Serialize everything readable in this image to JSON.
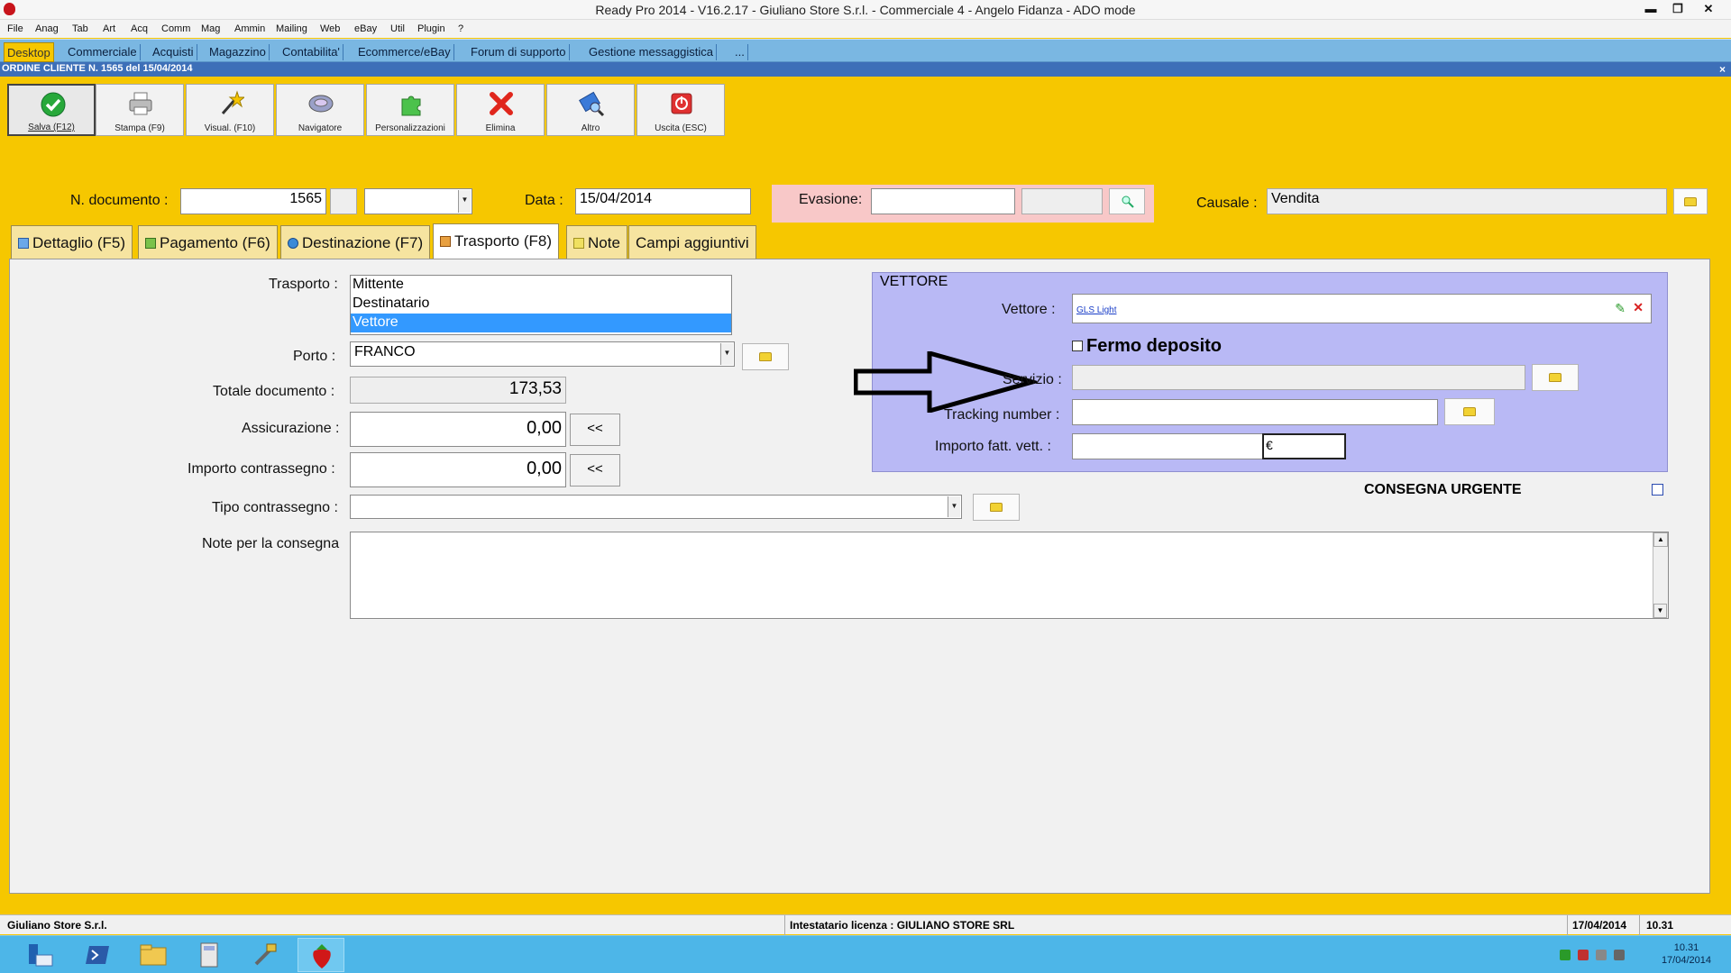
{
  "window": {
    "title": "Ready Pro 2014 - V16.2.17 - Giuliano Store S.r.l. - Commerciale 4 - Angelo Fidanza - ADO mode",
    "min": "▬",
    "restore": "❐",
    "close": "✕"
  },
  "menu": [
    "File",
    "Anag",
    "Tab",
    "Art",
    "Acq",
    "Comm",
    "Mag",
    "Ammin",
    "Mailing",
    "Web",
    "eBay",
    "Util",
    "Plugin",
    "?"
  ],
  "modules": [
    "Desktop",
    "Commerciale",
    "Acquisti",
    "Magazzino",
    "Contabilita'",
    "Ecommerce/eBay",
    "Forum di supporto",
    "Gestione messaggistica",
    "..."
  ],
  "doc_title": "ORDINE CLIENTE N. 1565 del 15/04/2014",
  "doc_close": "×",
  "toolbar": [
    {
      "label": "Salva (F12)",
      "icon": "check-icon"
    },
    {
      "label": "Stampa (F9)",
      "icon": "printer-icon"
    },
    {
      "label": "Visual. (F10)",
      "icon": "magic-wand-icon"
    },
    {
      "label": "Navigatore",
      "icon": "navigator-icon"
    },
    {
      "label": "Personalizzazioni",
      "icon": "puzzle-icon"
    },
    {
      "label": "Elimina",
      "icon": "delete-x-icon"
    },
    {
      "label": "Altro",
      "icon": "altro-icon"
    },
    {
      "label": "Uscita (ESC)",
      "icon": "exit-icon"
    }
  ],
  "header": {
    "ndoc_label": "N. documento :",
    "ndoc_value": "1565",
    "data_label": "Data :",
    "data_value": "15/04/2014",
    "evasione_label": "Evasione:",
    "evasione_value": "",
    "causale_label": "Causale :",
    "causale_value": "Vendita"
  },
  "tabs": [
    "Dettaglio (F5)",
    "Pagamento (F6)",
    "Destinazione (F7)",
    "Trasporto (F8)",
    "Note",
    "Campi aggiuntivi"
  ],
  "active_tab": "Trasporto (F8)",
  "trasporto": {
    "trasporto_label": "Trasporto :",
    "trasporto_options": [
      "Mittente",
      "Destinatario",
      "Vettore"
    ],
    "trasporto_selected": "Vettore",
    "porto_label": "Porto :",
    "porto_value": "FRANCO",
    "totale_label": "Totale documento :",
    "totale_value": "173,53",
    "assicurazione_label": "Assicurazione :",
    "assicurazione_value": "0,00",
    "importo_contr_label": "Importo contrassegno :",
    "importo_contr_value": "0,00",
    "tipo_contr_label": "Tipo contrassegno :",
    "tipo_contr_value": "",
    "note_label": "Note per la consegna",
    "note_value": "",
    "copy_button": "<<"
  },
  "vettore": {
    "group_title": "VETTORE",
    "vettore_label": "Vettore :",
    "vettore_value": "GLS Light",
    "fermo_label": "Fermo deposito",
    "fermo_checked": false,
    "servizio_label": "Servizio :",
    "servizio_value": "",
    "tracking_label": "Tracking number :",
    "tracking_value": "",
    "importo_label": "Importo fatt. vett. :",
    "importo_value": "",
    "currency": "€"
  },
  "consegna_urgente": {
    "label": "CONSEGNA URGENTE",
    "checked": false
  },
  "statusbar": {
    "company": "Giuliano Store S.r.l.",
    "license": "Intestatario licenza : GIULIANO STORE SRL",
    "date": "17/04/2014",
    "time": "10.31"
  },
  "taskbar": {
    "clock_time": "10.31",
    "clock_date": "17/04/2014"
  },
  "colors": {
    "background": "#f6c700",
    "module_bar": "#7ab7e2",
    "vettore_group": "#b9b9f5",
    "evasione_box": "#f8c8c8",
    "selection": "#3399ff"
  }
}
